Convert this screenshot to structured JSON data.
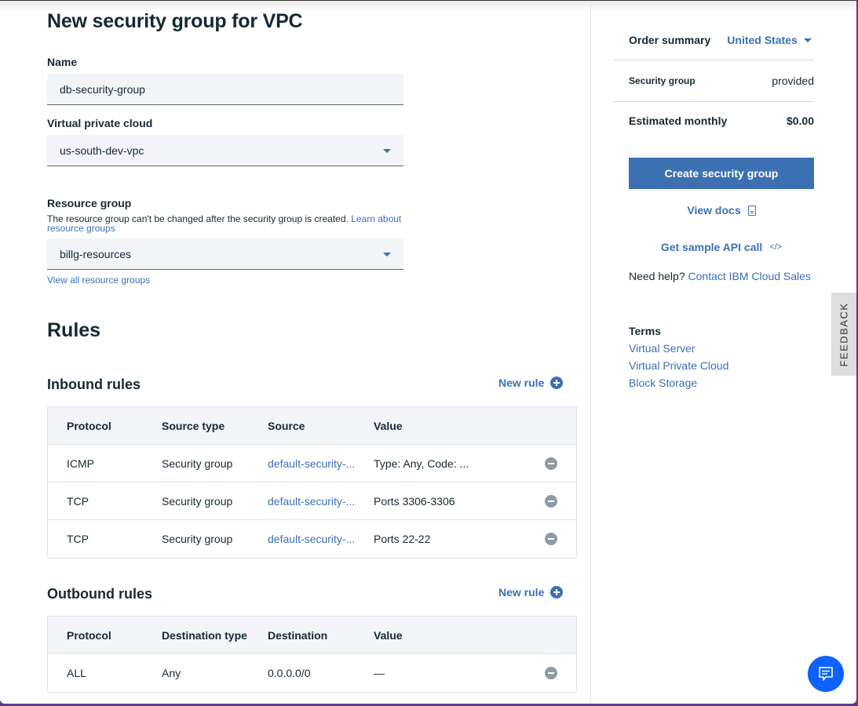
{
  "page": {
    "title": "New security group for VPC"
  },
  "form": {
    "name_label": "Name",
    "name_value": "db-security-group",
    "vpc_label": "Virtual private cloud",
    "vpc_value": "us-south-dev-vpc",
    "resource_group_label": "Resource group",
    "resource_group_helper": "The resource group can't be changed after the security group is created.",
    "resource_group_helper_link": "Learn about resource groups",
    "resource_group_value": "billg-resources",
    "view_all_link": "View all resource groups"
  },
  "rules": {
    "title": "Rules",
    "inbound": {
      "title": "Inbound rules",
      "new_rule_label": "New rule",
      "columns": [
        "Protocol",
        "Source type",
        "Source",
        "Value"
      ],
      "rows": [
        {
          "protocol": "ICMP",
          "type": "Security group",
          "target": "default-security-...",
          "value": "Type: Any, Code: ..."
        },
        {
          "protocol": "TCP",
          "type": "Security group",
          "target": "default-security-...",
          "value": "Ports 3306-3306"
        },
        {
          "protocol": "TCP",
          "type": "Security group",
          "target": "default-security-...",
          "value": "Ports 22-22"
        }
      ]
    },
    "outbound": {
      "title": "Outbound rules",
      "new_rule_label": "New rule",
      "columns": [
        "Protocol",
        "Destination type",
        "Destination",
        "Value"
      ],
      "rows": [
        {
          "protocol": "ALL",
          "type": "Any",
          "target": "0.0.0.0/0",
          "value": "—"
        }
      ]
    }
  },
  "summary": {
    "title": "Order summary",
    "region": "United States",
    "item_label": "Security group",
    "item_value": "provided",
    "estimate_label": "Estimated monthly",
    "estimate_value": "$0.00",
    "create_button": "Create security group",
    "view_docs": "View docs",
    "sample_api": "Get sample API call",
    "code_glyph": "</>",
    "help_text": "Need help?",
    "help_link": "Contact IBM Cloud Sales",
    "terms_title": "Terms",
    "terms_links": [
      "Virtual Server",
      "Virtual Private Cloud",
      "Block Storage"
    ]
  },
  "feedback_label": "FEEDBACK",
  "colors": {
    "primary": "#3d70b2",
    "chat": "#0f62fe",
    "text": "#152935",
    "field_bg": "#f2f4f8"
  }
}
